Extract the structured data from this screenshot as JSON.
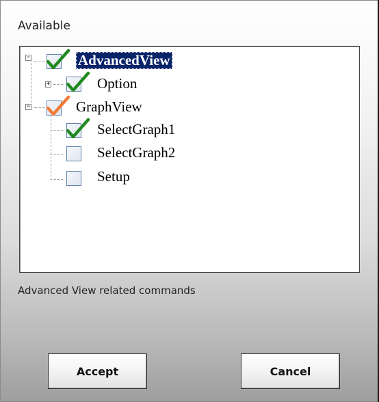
{
  "available_label": "Available",
  "tree": {
    "nodes": [
      {
        "label": "AdvancedView",
        "checked": true,
        "expander": "−"
      },
      {
        "label": "Option",
        "checked": true,
        "expander": "+"
      },
      {
        "label": "GraphView",
        "checked": "partial",
        "expander": "−"
      },
      {
        "label": "SelectGraph1",
        "checked": true
      },
      {
        "label": "SelectGraph2",
        "checked": false
      },
      {
        "label": "Setup",
        "checked": false
      }
    ]
  },
  "description": "Advanced View related commands",
  "buttons": {
    "accept": "Accept",
    "cancel": "Cancel"
  },
  "colors": {
    "check_green": "#1f8a1f",
    "check_partial": "#f07a3a",
    "selection_bg": "#0a246a"
  }
}
